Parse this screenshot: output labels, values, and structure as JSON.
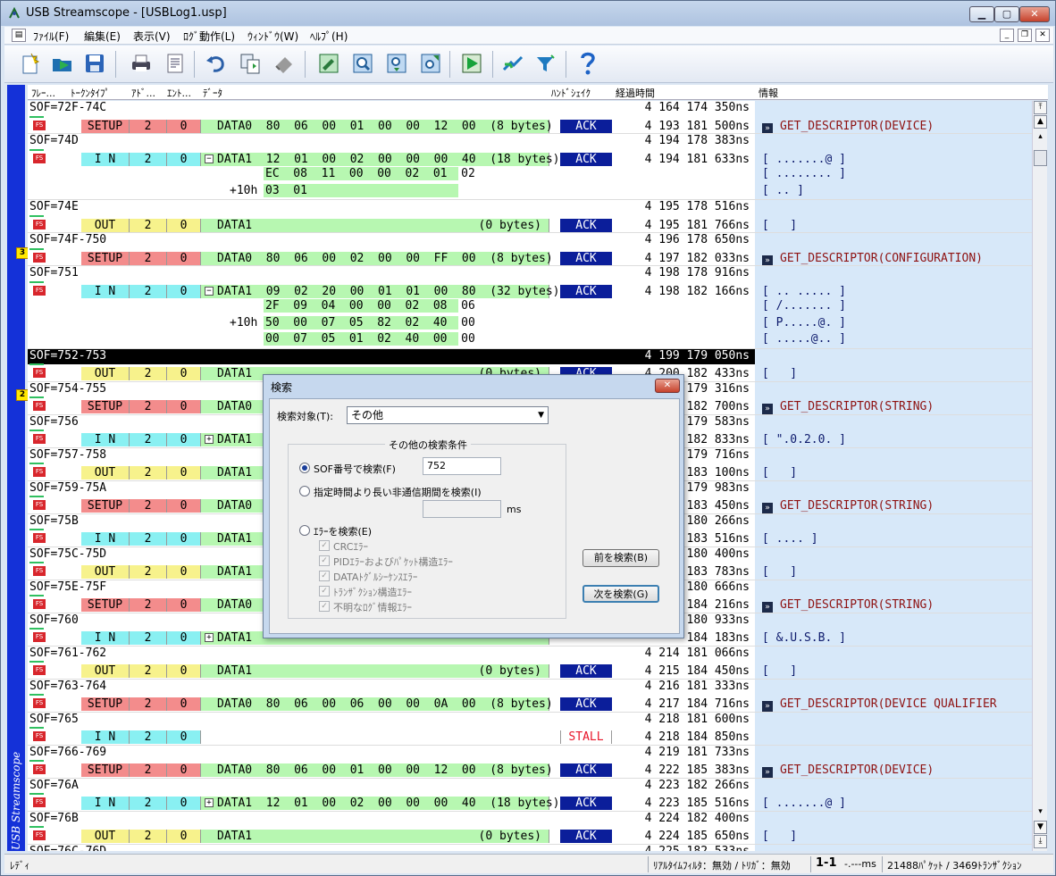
{
  "window": {
    "title": "USB Streamscope - [USBLog1.usp]"
  },
  "menu": [
    "ﾌｧｲﾙ(F)",
    "編集(E)",
    "表示(V)",
    "ﾛｸﾞ動作(L)",
    "ｳｨﾝﾄﾞｳ(W)",
    "ﾍﾙﾌﾟ(H)"
  ],
  "toolbar": [
    "new-icon",
    "open-icon",
    "save-icon",
    "print-icon",
    "print-preview-icon",
    "undo-icon",
    "copy-icon",
    "erase-icon",
    "edit-icon",
    "search-icon",
    "search-down-icon",
    "search-up-icon",
    "start-capture-icon",
    "network-icon",
    "filter-icon",
    "help-icon"
  ],
  "columns": [
    "ﾌﾚｰ...",
    "ﾄｰｸﾝﾀｲﾌﾟ",
    "ｱﾄﾞ...",
    "ｴﾝﾄ...",
    "ﾃﾞｰﾀ",
    "ﾊﾝﾄﾞｼｪｲｸ",
    "経過時間",
    "情報"
  ],
  "sidebar": {
    "label": "USB Streamscope",
    "bookmarks": [
      "3",
      "2"
    ]
  },
  "rows": [
    {
      "kind": "sof",
      "text": "SOF=72F-74C",
      "time": "4 164 174 350ns"
    },
    {
      "kind": "tx",
      "pid": "SETUP",
      "addr": "2",
      "ep": "0",
      "data": "DATA0  80  06  00  01  00  00  12  00  (8 bytes)",
      "hs": "ACK",
      "time": "4 193 181 500ns",
      "info": "GET_DESCRIPTOR(DEVICE)"
    },
    {
      "kind": "sof",
      "text": "SOF=74D",
      "time": "4 194 178 383ns"
    },
    {
      "kind": "tx",
      "pid": "I N",
      "addr": "2",
      "ep": "0",
      "exp": "⊟",
      "data": "DATA1  12  01  00  02  00  00  00  40  (18 bytes)",
      "hs": "ACK",
      "time": "4 194 181 633ns",
      "info": "[ .......@ ]",
      "asc": true
    },
    {
      "kind": "cont",
      "data": "EC  08  11  00  00  02  01  02",
      "info": "[ ........ ]"
    },
    {
      "kind": "cont",
      "off": "+10h",
      "data": "03  01",
      "info": "[ .. ]"
    },
    {
      "kind": "sof",
      "text": "SOF=74E",
      "time": "4 195 178 516ns"
    },
    {
      "kind": "tx",
      "pid": "OUT",
      "addr": "2",
      "ep": "0",
      "data": "DATA1",
      "dlen": "(0 bytes)",
      "hs": "ACK",
      "time": "4 195 181 766ns",
      "info": "[   ]",
      "asc": true
    },
    {
      "kind": "sof",
      "text": "SOF=74F-750",
      "time": "4 196 178 650ns"
    },
    {
      "kind": "tx",
      "pid": "SETUP",
      "addr": "2",
      "ep": "0",
      "data": "DATA0  80  06  00  02  00  00  FF  00  (8 bytes)",
      "hs": "ACK",
      "time": "4 197 182 033ns",
      "info": "GET_DESCRIPTOR(CONFIGURATION)",
      "bm": "3"
    },
    {
      "kind": "sof",
      "text": "SOF=751",
      "time": "4 198 178 916ns"
    },
    {
      "kind": "tx",
      "pid": "I N",
      "addr": "2",
      "ep": "0",
      "exp": "⊟",
      "data": "DATA1  09  02  20  00  01  01  00  80  (32 bytes)",
      "hs": "ACK",
      "time": "4 198 182 166ns",
      "info": "[ .. ..... ]",
      "asc": true
    },
    {
      "kind": "cont",
      "data": "2F  09  04  00  00  02  08  06",
      "info": "[ /....... ]"
    },
    {
      "kind": "cont",
      "off": "+10h",
      "data": "50  00  07  05  82  02  40  00",
      "info": "[ P.....@. ]"
    },
    {
      "kind": "cont",
      "data": "00  07  05  01  02  40  00  00",
      "info": "[ .....@.. ]"
    },
    {
      "kind": "sofsel",
      "text": "SOF=752-753",
      "time": "4 199 179 050ns"
    },
    {
      "kind": "tx",
      "pid": "OUT",
      "addr": "2",
      "ep": "0",
      "data": "DATA1",
      "dlen": "(0 bytes)",
      "hs": "ACK",
      "time": "4 200 182 433ns",
      "info": "[   ]",
      "asc": true
    },
    {
      "kind": "sof",
      "text": "SOF=754-755",
      "time": "179 316ns"
    },
    {
      "kind": "tx",
      "pid": "SETUP",
      "addr": "2",
      "ep": "0",
      "data": "DATA0",
      "hs": "",
      "time": "182 700ns",
      "info": "GET_DESCRIPTOR(STRING)",
      "bm": "2"
    },
    {
      "kind": "sof",
      "text": "SOF=756",
      "time": "179 583ns"
    },
    {
      "kind": "tx",
      "pid": "I N",
      "addr": "2",
      "ep": "0",
      "exp": "⊞",
      "data": "DATA1",
      "hs": "",
      "time": "182 833ns",
      "info": "[ \".0.2.0. ]",
      "asc": true
    },
    {
      "kind": "sof",
      "text": "SOF=757-758",
      "time": "179 716ns"
    },
    {
      "kind": "tx",
      "pid": "OUT",
      "addr": "2",
      "ep": "0",
      "data": "DATA1",
      "hs": "",
      "time": "183 100ns",
      "info": "[   ]",
      "asc": true
    },
    {
      "kind": "sof",
      "text": "SOF=759-75A",
      "time": "179 983ns"
    },
    {
      "kind": "tx",
      "pid": "SETUP",
      "addr": "2",
      "ep": "0",
      "data": "DATA0",
      "hs": "",
      "time": "183 450ns",
      "info": "GET_DESCRIPTOR(STRING)"
    },
    {
      "kind": "sof",
      "text": "SOF=75B",
      "time": "180 266ns"
    },
    {
      "kind": "tx",
      "pid": "I N",
      "addr": "2",
      "ep": "0",
      "data": "DATA1",
      "hs": "",
      "time": "183 516ns",
      "info": "[ .... ]",
      "asc": true
    },
    {
      "kind": "sof",
      "text": "SOF=75C-75D",
      "time": "180 400ns"
    },
    {
      "kind": "tx",
      "pid": "OUT",
      "addr": "2",
      "ep": "0",
      "data": "DATA1",
      "hs": "",
      "time": "183 783ns",
      "info": "[   ]",
      "asc": true
    },
    {
      "kind": "sof",
      "text": "SOF=75E-75F",
      "time": "180 666ns"
    },
    {
      "kind": "tx",
      "pid": "SETUP",
      "addr": "2",
      "ep": "0",
      "data": "DATA0",
      "hs": "",
      "time": "184 216ns",
      "info": "GET_DESCRIPTOR(STRING)"
    },
    {
      "kind": "sof",
      "text": "SOF=760",
      "time": "180 933ns"
    },
    {
      "kind": "tx",
      "pid": "I N",
      "addr": "2",
      "ep": "0",
      "exp": "⊞",
      "data": "DATA1",
      "hs": "",
      "time": "184 183ns",
      "info": "[ &.U.S.B. ]",
      "asc": true
    },
    {
      "kind": "sof",
      "text": "SOF=761-762",
      "time": "4 214 181 066ns"
    },
    {
      "kind": "tx",
      "pid": "OUT",
      "addr": "2",
      "ep": "0",
      "data": "DATA1",
      "dlen": "(0 bytes)",
      "hs": "ACK",
      "time": "4 215 184 450ns",
      "info": "[   ]",
      "asc": true
    },
    {
      "kind": "sof",
      "text": "SOF=763-764",
      "time": "4 216 181 333ns"
    },
    {
      "kind": "tx",
      "pid": "SETUP",
      "addr": "2",
      "ep": "0",
      "data": "DATA0  80  06  00  06  00  00  0A  00  (8 bytes)",
      "hs": "ACK",
      "time": "4 217 184 716ns",
      "info": "GET_DESCRIPTOR(DEVICE QUALIFIER"
    },
    {
      "kind": "sof",
      "text": "SOF=765",
      "time": "4 218 181 600ns"
    },
    {
      "kind": "tx",
      "pid": "I N",
      "addr": "2",
      "ep": "0",
      "data": "",
      "hs": "STALL",
      "time": "4 218 184 850ns",
      "info": ""
    },
    {
      "kind": "sof",
      "text": "SOF=766-769",
      "time": "4 219 181 733ns"
    },
    {
      "kind": "tx",
      "pid": "SETUP",
      "addr": "2",
      "ep": "0",
      "data": "DATA0  80  06  00  01  00  00  12  00  (8 bytes)",
      "hs": "ACK",
      "time": "4 222 185 383ns",
      "info": "GET_DESCRIPTOR(DEVICE)"
    },
    {
      "kind": "sof",
      "text": "SOF=76A",
      "time": "4 223 182 266ns"
    },
    {
      "kind": "tx",
      "pid": "I N",
      "addr": "2",
      "ep": "0",
      "exp": "⊞",
      "data": "DATA1  12  01  00  02  00  00  00  40  (18 bytes)",
      "hs": "ACK",
      "time": "4 223 185 516ns",
      "info": "[ .......@ ]",
      "asc": true
    },
    {
      "kind": "sof",
      "text": "SOF=76B",
      "time": "4 224 182 400ns"
    },
    {
      "kind": "tx",
      "pid": "OUT",
      "addr": "2",
      "ep": "0",
      "data": "DATA1",
      "dlen": "(0 bytes)",
      "hs": "ACK",
      "time": "4 224 185 650ns",
      "info": "[   ]",
      "asc": true
    },
    {
      "kind": "sof",
      "text": "SOF=76C-76D",
      "time": "4 225 182 533ns"
    }
  ],
  "dialog": {
    "title": "検索",
    "target_label": "検索対象(T):",
    "target_value": "その他",
    "group_title": "その他の検索条件",
    "opt_sof": "SOF番号で検索(F)",
    "sof_value": "752",
    "opt_idle": "指定時間より長い非通信期間を検索(I)",
    "idle_unit": "ms",
    "opt_error": "ｴﾗｰを検索(E)",
    "checks": [
      "CRCｴﾗｰ",
      "PIDｴﾗｰおよびﾊﾟｹｯﾄ構造ｴﾗｰ",
      "DATAﾄｸﾞﾙｼｰｹﾝｽｴﾗｰ",
      "ﾄﾗﾝｻﾞｸｼｮﾝ構造ｴﾗｰ",
      "不明なﾛｸﾞ情報ｴﾗｰ"
    ],
    "prev_button": "前を検索(B)",
    "next_button": "次を検索(G)"
  },
  "status": {
    "left": "ﾚﾃﾞｨ",
    "filter": "ﾘｱﾙﾀｲﾑﾌｨﾙﾀ：無効 / ﾄﾘｶﾞ：無効",
    "pos": "1-1",
    "ms": "-.---ms",
    "counts": "21488ﾊﾟｹｯﾄ / 3469ﾄﾗﾝｻﾞｸｼｮﾝ"
  },
  "colors": {
    "setup": "#f38c8c",
    "in": "#89f0f2",
    "out": "#f7f28c",
    "data": "#b7f7b1",
    "ack": "#0b1e9a",
    "sidebar": "#1431d8",
    "info_bg": "#d7e8f9"
  }
}
